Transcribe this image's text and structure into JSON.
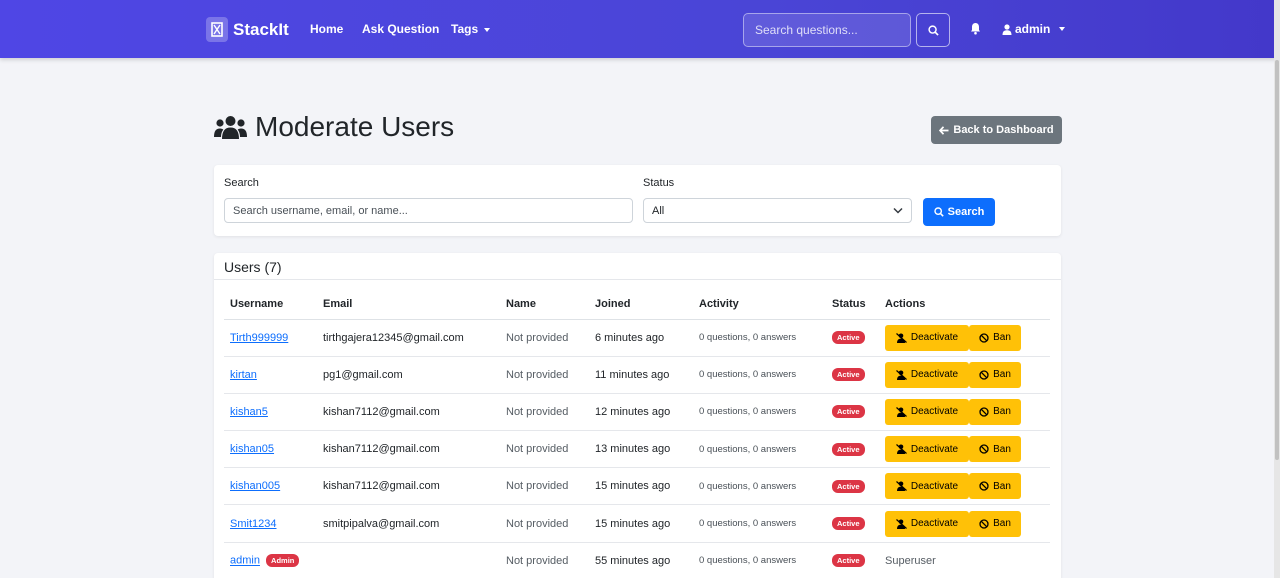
{
  "navbar": {
    "brand": "StackIt",
    "links": [
      "Home",
      "Ask Question",
      "Tags"
    ],
    "search_placeholder": "Search questions...",
    "user": "admin"
  },
  "page": {
    "title": "Moderate Users",
    "back_label": "Back to Dashboard"
  },
  "filters": {
    "search_label": "Search",
    "search_placeholder": "Search username, email, or name...",
    "status_label": "Status",
    "status_value": "All",
    "search_button": "Search"
  },
  "users": {
    "header": "Users (7)",
    "columns": [
      "Username",
      "Email",
      "Name",
      "Joined",
      "Activity",
      "Status",
      "Actions"
    ],
    "deactivate_label": "Deactivate",
    "ban_label": "Ban",
    "rows": [
      {
        "username": "Tirth999999",
        "email": "tirthgajera12345@gmail.com",
        "name": "Not provided",
        "joined": "6 minutes ago",
        "activity": "0 questions, 0 answers",
        "status": "Active"
      },
      {
        "username": "kirtan",
        "email": "pg1@gmail.com",
        "name": "Not provided",
        "joined": "11 minutes ago",
        "activity": "0 questions, 0 answers",
        "status": "Active"
      },
      {
        "username": "kishan5",
        "email": "kishan7112@gmail.com",
        "name": "Not provided",
        "joined": "12 minutes ago",
        "activity": "0 questions, 0 answers",
        "status": "Active"
      },
      {
        "username": "kishan05",
        "email": "kishan7112@gmail.com",
        "name": "Not provided",
        "joined": "13 minutes ago",
        "activity": "0 questions, 0 answers",
        "status": "Active"
      },
      {
        "username": "kishan005",
        "email": "kishan7112@gmail.com",
        "name": "Not provided",
        "joined": "15 minutes ago",
        "activity": "0 questions, 0 answers",
        "status": "Active"
      },
      {
        "username": "Smit1234",
        "email": "smitpipalva@gmail.com",
        "name": "Not provided",
        "joined": "15 minutes ago",
        "activity": "0 questions, 0 answers",
        "status": "Active"
      },
      {
        "username": "admin",
        "role_badge": "Admin",
        "email": "",
        "name": "Not provided",
        "joined": "55 minutes ago",
        "activity": "0 questions, 0 answers",
        "status": "Active",
        "action_text": "Superuser"
      }
    ]
  },
  "colors": {
    "navbar": "#4f46e5",
    "primary": "#0d6efd",
    "warning": "#ffc107",
    "danger": "#dc3545",
    "secondary": "#6c757d"
  }
}
